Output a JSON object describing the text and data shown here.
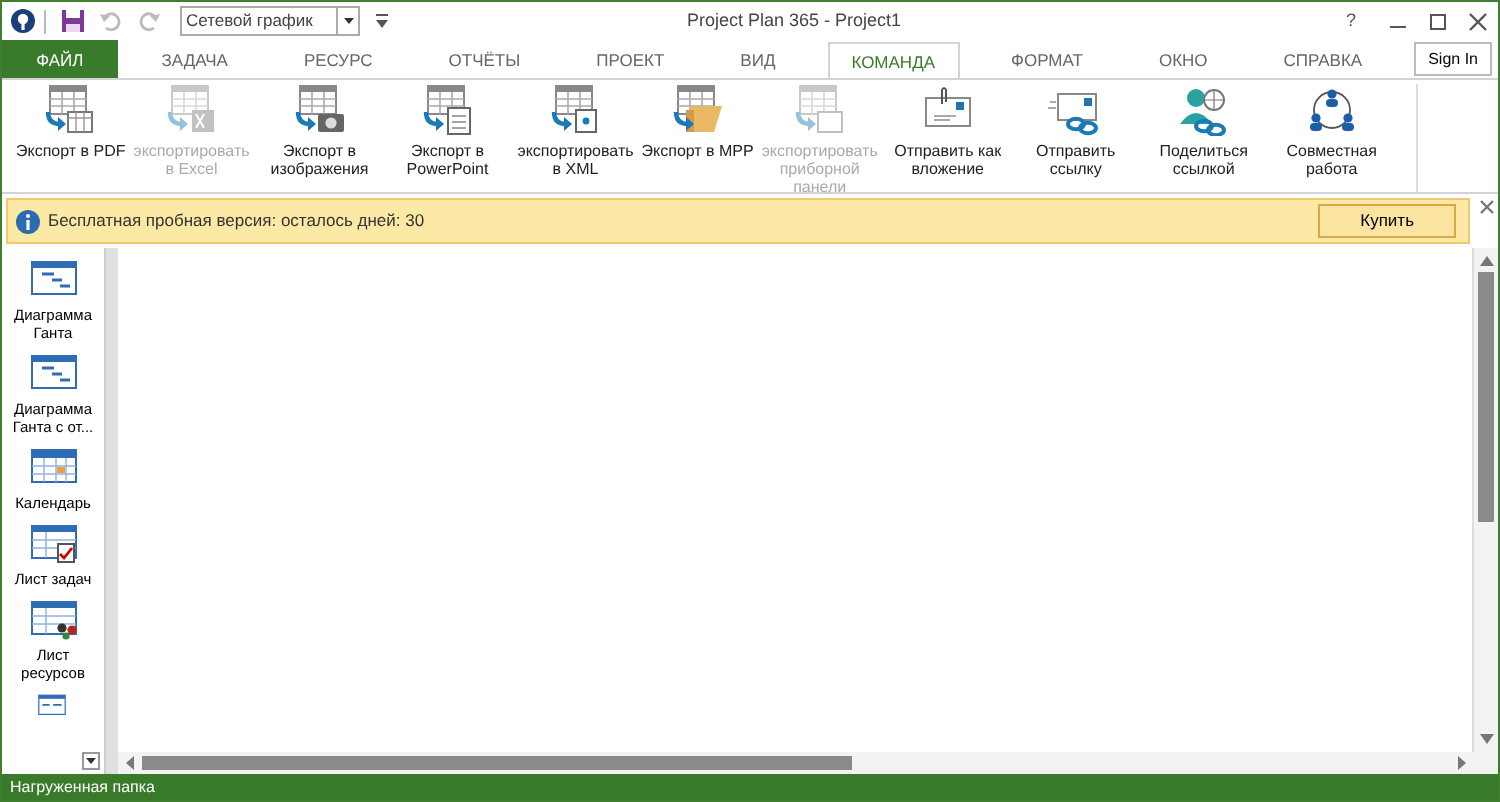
{
  "window": {
    "title": "Project Plan 365 - Project1",
    "help": "?"
  },
  "quick_access": [
    {
      "kind": "save",
      "disabled": false
    },
    {
      "kind": "undo",
      "disabled": true
    },
    {
      "kind": "redo",
      "disabled": true
    }
  ],
  "view_select": "Сетевой график",
  "sign_in": "Sign In",
  "tabs": [
    {
      "label": "ФАЙЛ",
      "kind": "file",
      "selected": false
    },
    {
      "label": "ЗАДАЧА",
      "kind": "tab",
      "selected": false
    },
    {
      "label": "РЕСУРС",
      "kind": "tab",
      "selected": false
    },
    {
      "label": "ОТЧЁТЫ",
      "kind": "tab",
      "selected": false
    },
    {
      "label": "ПРОЕКТ",
      "kind": "tab",
      "selected": false
    },
    {
      "label": "ВИД",
      "kind": "tab",
      "selected": false
    },
    {
      "label": "КОМАНДА",
      "kind": "tab",
      "selected": true
    },
    {
      "label": "ФОРМАТ",
      "kind": "tab",
      "selected": false
    },
    {
      "label": "ОКНО",
      "kind": "tab",
      "selected": false
    },
    {
      "label": "СПРАВКА",
      "kind": "tab",
      "selected": false
    }
  ],
  "ribbon": [
    {
      "label": "Экспорт в PDF",
      "kind": "pdf",
      "disabled": false
    },
    {
      "label": "экспортировать в Excel",
      "kind": "excel",
      "disabled": true
    },
    {
      "label": "Экспорт в изображения",
      "kind": "image",
      "disabled": false
    },
    {
      "label": "Экспорт в PowerPoint",
      "kind": "ppt",
      "disabled": false
    },
    {
      "label": "экспортировать в XML",
      "kind": "xml",
      "disabled": false
    },
    {
      "label": "Экспорт в MPP",
      "kind": "mpp",
      "disabled": false
    },
    {
      "label": "экспортировать приборной панели",
      "kind": "dashboard",
      "disabled": true
    },
    {
      "label": "Отправить как вложение",
      "kind": "attach",
      "disabled": false
    },
    {
      "label": "Отправить ссылку",
      "kind": "link",
      "disabled": false
    },
    {
      "label": "Поделиться ссылкой",
      "kind": "share",
      "disabled": false
    },
    {
      "label": "Совместная работа",
      "kind": "collab",
      "disabled": false
    }
  ],
  "trial_bar": {
    "message": "Бесплатная пробная версия: осталось дней: 30",
    "buy": "Купить"
  },
  "views": [
    {
      "label": "Диаграмма Ганта",
      "kind": "gantt"
    },
    {
      "label": "Диаграмма Ганта с от...",
      "kind": "gantt"
    },
    {
      "label": "Календарь",
      "kind": "calendar"
    },
    {
      "label": "Лист задач",
      "kind": "tasks"
    },
    {
      "label": "Лист ресурсов",
      "kind": "resources"
    },
    {
      "kind": "form"
    }
  ],
  "status_bar": "Нагруженная папка"
}
